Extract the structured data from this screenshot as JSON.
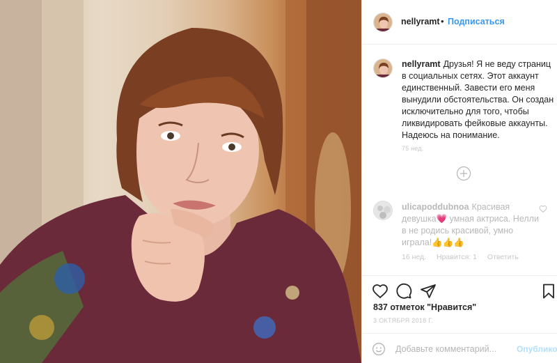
{
  "post": {
    "image_description_icon": "portrait-photo",
    "username": "nellyramt",
    "follow_label": "Подписаться",
    "separator": "•",
    "caption_text": "Друзья! Я не веду страниц в социальных сетях. Этот аккаунт единственный. Завести его меня вынудили обстоятельства. Он создан исключительно для того, чтобы ликвидировать фейковые аккаунты. Надеюсь на понимание.",
    "caption_time": "75 нед.",
    "load_more_icon": "plus-circle-icon"
  },
  "comment": {
    "username": "ulicapoddubnoa",
    "text": "Красивая девушка💗 умная актриса. Нелли в не родись красивой, умно играла!👍👍👍",
    "time": "16 нед.",
    "likes": "Нравится: 1",
    "reply": "Ответить"
  },
  "actions": {
    "like_icon": "heart-icon",
    "comment_icon": "comment-icon",
    "share_icon": "share-icon",
    "save_icon": "bookmark-icon"
  },
  "likes_text": "837 отметок \"Нравится\"",
  "date_text": "3 октября 2018 г.",
  "add_comment": {
    "placeholder": "Добавьте комментарий...",
    "publish_label": "Опубликовать",
    "emoji_icon": "emoji-icon"
  },
  "colors": {
    "accent": "#3897f0",
    "text": "#262626",
    "muted": "#c7c7c7"
  }
}
